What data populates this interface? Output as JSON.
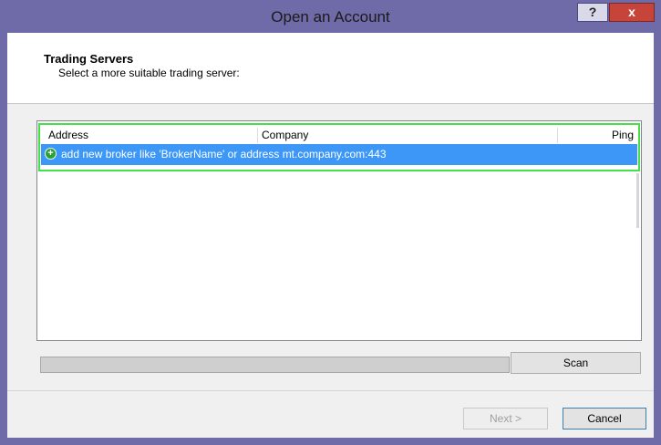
{
  "window": {
    "title": "Open an Account",
    "help_label": "?",
    "close_label": "x"
  },
  "header": {
    "title": "Trading Servers",
    "subtitle": "Select a more suitable trading server:"
  },
  "table": {
    "columns": [
      "Address",
      "Company",
      "Ping"
    ],
    "rows": [
      {
        "text": "add new broker like 'BrokerName' or address mt.company.com:443",
        "icon": "add-icon",
        "selected": true
      }
    ]
  },
  "scan_label": "Scan",
  "footer": {
    "next_label": "Next >",
    "cancel_label": "Cancel"
  },
  "colors": {
    "titlebar": "#6f6ba8",
    "selection": "#3d97f6",
    "focus_frame": "#46e046"
  }
}
